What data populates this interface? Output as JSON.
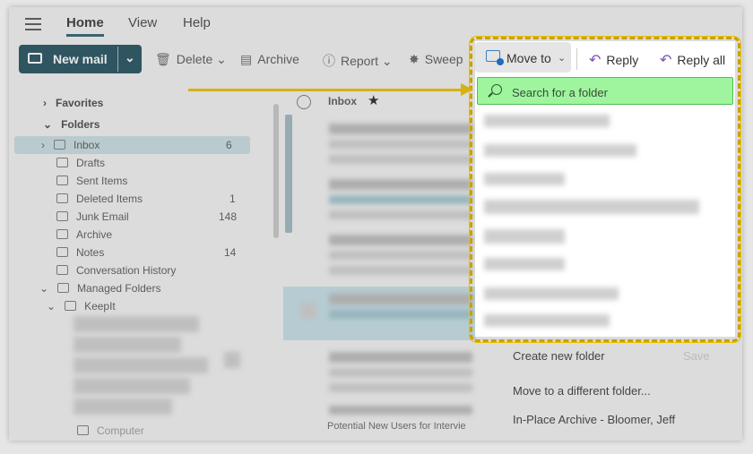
{
  "menu": {
    "home": "Home",
    "view": "View",
    "help": "Help"
  },
  "ribbon": {
    "new_mail": "New mail",
    "delete": "Delete",
    "archive": "Archive",
    "report": "Report",
    "sweep": "Sweep",
    "move_to": "Move to",
    "reply": "Reply",
    "reply_all": "Reply all"
  },
  "sidebar": {
    "favorites": "Favorites",
    "folders": "Folders",
    "items": [
      {
        "label": "Inbox",
        "count": "6"
      },
      {
        "label": "Drafts",
        "count": ""
      },
      {
        "label": "Sent Items",
        "count": ""
      },
      {
        "label": "Deleted Items",
        "count": "1"
      },
      {
        "label": "Junk Email",
        "count": "148"
      },
      {
        "label": "Archive",
        "count": ""
      },
      {
        "label": "Notes",
        "count": "14"
      },
      {
        "label": "Conversation History",
        "count": ""
      },
      {
        "label": "Managed Folders",
        "count": ""
      },
      {
        "label": "KeepIt",
        "count": ""
      },
      {
        "label": "Computer",
        "count": ""
      }
    ]
  },
  "message_list": {
    "header": "Inbox",
    "visible_subject": "Potential New Users for Intervie"
  },
  "move_menu": {
    "search_placeholder": "Search for a folder",
    "create_new_folder": "Create new folder",
    "save": "Save",
    "move_to_different": "Move to a different folder...",
    "in_place_archive": "In-Place Archive - Bloomer, Jeff"
  },
  "colors": {
    "accent": "#1f4e5c",
    "highlight_outline": "#c9a100",
    "search_highlight": "#9ef59e"
  }
}
